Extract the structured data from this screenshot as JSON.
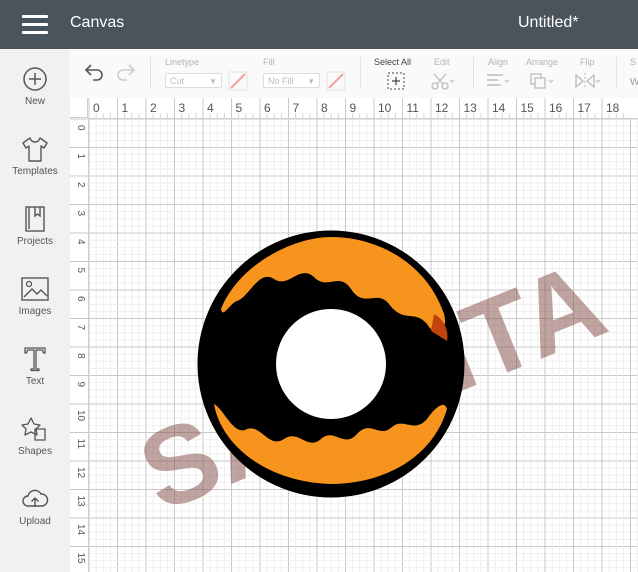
{
  "header": {
    "app_title": "Canvas",
    "doc_title": "Untitled*"
  },
  "sidebar": {
    "items": [
      {
        "label": "New",
        "icon": "plus-circle-icon"
      },
      {
        "label": "Templates",
        "icon": "tshirt-icon"
      },
      {
        "label": "Projects",
        "icon": "bookmark-book-icon"
      },
      {
        "label": "Images",
        "icon": "image-icon"
      },
      {
        "label": "Text",
        "icon": "text-t-icon"
      },
      {
        "label": "Shapes",
        "icon": "shapes-icon"
      },
      {
        "label": "Upload",
        "icon": "cloud-upload-icon"
      }
    ]
  },
  "toolbar": {
    "linetype_label": "Linetype",
    "linetype_value": "Cut",
    "fill_label": "Fill",
    "fill_value": "No Fill",
    "select_all_label": "Select All",
    "edit_label": "Edit",
    "align_label": "Align",
    "arrange_label": "Arrange",
    "flip_label": "Flip",
    "size_label_partial": "S",
    "size_label_partial2": "W"
  },
  "rulers": {
    "h_ticks": [
      "0",
      "1",
      "2",
      "3",
      "4",
      "5",
      "6",
      "7",
      "8",
      "9",
      "10",
      "11",
      "12",
      "13",
      "14",
      "15",
      "16",
      "17",
      "18"
    ],
    "v_ticks": [
      "0",
      "1",
      "2",
      "3",
      "4",
      "5",
      "6",
      "7",
      "8",
      "9",
      "10",
      "11",
      "12",
      "13",
      "14",
      "15"
    ]
  },
  "design": {
    "watermark_text": "SASMITA",
    "ring_color": "#000000",
    "frosting_color": "#f7941d",
    "accent_color": "#c1440e"
  }
}
